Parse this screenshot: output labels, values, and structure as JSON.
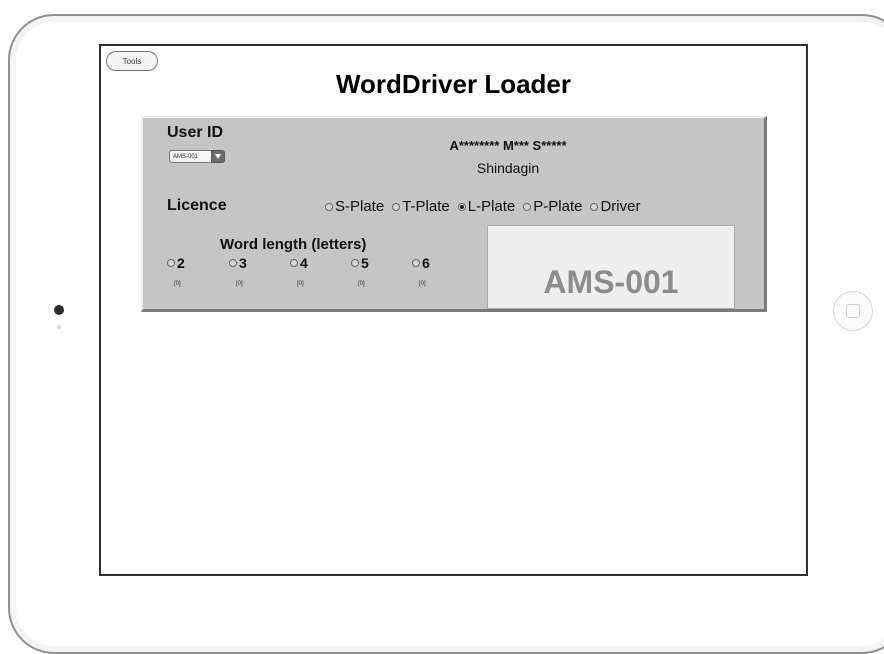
{
  "toolbar": {
    "tools_label": "Tools"
  },
  "page": {
    "title": "WordDriver Loader"
  },
  "user": {
    "label": "User ID",
    "selected_id": "AMS-001",
    "name": "A******** M*** S*****",
    "school": "Shindagin"
  },
  "licence": {
    "label": "Licence",
    "options": [
      {
        "label": "S-Plate",
        "selected": false
      },
      {
        "label": "T-Plate",
        "selected": false
      },
      {
        "label": "L-Plate",
        "selected": true
      },
      {
        "label": "P-Plate",
        "selected": false
      },
      {
        "label": "Driver",
        "selected": false
      }
    ]
  },
  "word_length": {
    "label": "Word length (letters)",
    "options": [
      {
        "label": "2",
        "count": "[0]"
      },
      {
        "label": "3",
        "count": "[0]"
      },
      {
        "label": "4",
        "count": "[0]"
      },
      {
        "label": "5",
        "count": "[0]"
      },
      {
        "label": "6",
        "count": "[0]"
      }
    ]
  },
  "display": {
    "id_text": "AMS-001"
  },
  "icons": {
    "userid_arrow": "chevron-down-icon",
    "home": "home-button-icon",
    "camera": "camera-icon"
  }
}
